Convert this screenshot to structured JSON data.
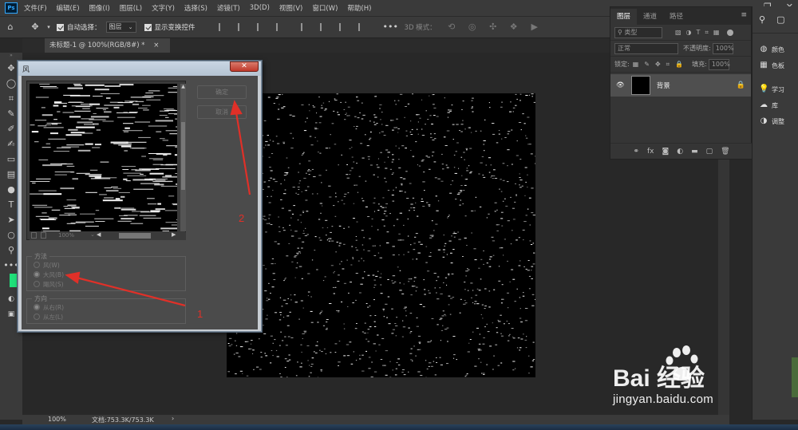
{
  "app": {
    "logo_text": "Ps",
    "menus": [
      "文件(F)",
      "编辑(E)",
      "图像(I)",
      "图层(L)",
      "文字(Y)",
      "选择(S)",
      "滤镜(T)",
      "3D(D)",
      "视图(V)",
      "窗口(W)",
      "帮助(H)"
    ],
    "window_controls": [
      "—",
      "❐",
      "✕"
    ]
  },
  "options_bar": {
    "auto_select_label": "自动选择：",
    "auto_select_target": "图层",
    "show_transform_label": "显示变换控件",
    "mode_3d_label": "3D 模式："
  },
  "document": {
    "tab_title": "未标题-1 @ 100%(RGB/8#) *",
    "tab_close": "×",
    "zoom": "100%",
    "doc_info": "文档:753.3K/753.3K"
  },
  "layers_panel": {
    "tabs": [
      "图层",
      "通道",
      "路径"
    ],
    "filter_placeholder": "类型",
    "blend_mode": "正常",
    "opacity_label": "不透明度:",
    "opacity_value": "100%",
    "lock_label": "锁定:",
    "fill_label": "填充:",
    "fill_value": "100%",
    "layer_name": "背景",
    "bottom_icons": [
      "link-icon",
      "fx-icon",
      "mask-icon",
      "adjustment-icon",
      "folder-icon",
      "new-layer-icon",
      "trash-icon"
    ]
  },
  "side_panels": {
    "items": [
      {
        "icon": "color-icon",
        "label": "颜色"
      },
      {
        "icon": "swatches-icon",
        "label": "色板"
      },
      {
        "icon": "learn-icon",
        "label": "学习"
      },
      {
        "icon": "library-icon",
        "label": "库"
      },
      {
        "icon": "adjustments-icon",
        "label": "调整"
      }
    ]
  },
  "wind_dialog": {
    "title": "风",
    "close_label": "✕",
    "ok_label": "确定",
    "cancel_label": "取消",
    "zoom_value": "100%",
    "method_legend": "方法",
    "method_options": [
      "风(W)",
      "大风(B)",
      "飓风(S)"
    ],
    "method_selected": 1,
    "direction_legend": "方向",
    "direction_options": [
      "从右(R)",
      "从左(L)"
    ],
    "direction_selected": 0
  },
  "annotations": {
    "labels": [
      "1",
      "2"
    ],
    "color": "#e03028"
  },
  "watermark": {
    "brand": "Bai 经验",
    "url": "jingyan.baidu.com"
  },
  "colors": {
    "foreground": "#1fe07a",
    "accent_red": "#e03028"
  }
}
